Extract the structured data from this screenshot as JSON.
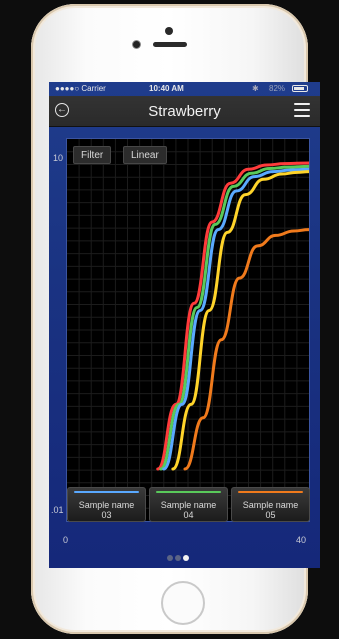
{
  "status_bar": {
    "carrier": "●●●●○ Carrier",
    "time": "10:40 AM",
    "bluetooth": "✱",
    "battery": "82%"
  },
  "nav": {
    "title": "Strawberry",
    "back_icon": "back-arrow-icon",
    "menu_icon": "hamburger-menu-icon"
  },
  "toolbar": {
    "filter_label": "Filter",
    "linear_label": "Linear"
  },
  "axes": {
    "y_top": "10",
    "y_bottom": ".01",
    "x_left": "0",
    "x_right": "40"
  },
  "legend": [
    {
      "label": "Sample name\n03",
      "color": "#5aa9ff"
    },
    {
      "label": "Sample name\n04",
      "color": "#59c95a"
    },
    {
      "label": "Sample name\n05",
      "color": "#f07a1c"
    }
  ],
  "chart_data": {
    "type": "line",
    "xlim": [
      0,
      40
    ],
    "ylim": [
      0.01,
      10
    ],
    "yscale": "log",
    "grid": true,
    "series": [
      {
        "color": "#ff3b3b",
        "x": [
          15,
          18,
          21,
          24,
          27,
          30,
          33,
          36,
          40
        ],
        "y": [
          0.01,
          0.04,
          0.35,
          2.0,
          4.6,
          6.2,
          6.8,
          7.0,
          7.1
        ]
      },
      {
        "color": "#59c95a",
        "x": [
          15.5,
          18.5,
          21.5,
          24.5,
          27.5,
          30.5,
          33.5,
          36.5,
          40
        ],
        "y": [
          0.01,
          0.04,
          0.32,
          1.9,
          4.3,
          5.7,
          6.3,
          6.5,
          6.6
        ]
      },
      {
        "color": "#5aa9ff",
        "x": [
          16,
          19,
          22,
          25,
          28,
          31,
          34,
          37,
          40
        ],
        "y": [
          0.01,
          0.04,
          0.3,
          1.7,
          3.9,
          5.3,
          5.9,
          6.1,
          6.2
        ]
      },
      {
        "color": "#ffd42a",
        "x": [
          17.5,
          20.5,
          23.5,
          26.5,
          29.5,
          32.5,
          35.5,
          38,
          40
        ],
        "y": [
          0.01,
          0.04,
          0.3,
          1.6,
          3.6,
          5.0,
          5.6,
          5.8,
          5.9
        ]
      },
      {
        "color": "#f07a1c",
        "x": [
          19.5,
          22.5,
          25.5,
          28.5,
          31.5,
          34.5,
          37.5,
          40
        ],
        "y": [
          0.01,
          0.03,
          0.16,
          0.6,
          1.2,
          1.5,
          1.65,
          1.7
        ]
      }
    ]
  },
  "pager": {
    "count": 3,
    "active": 2
  }
}
